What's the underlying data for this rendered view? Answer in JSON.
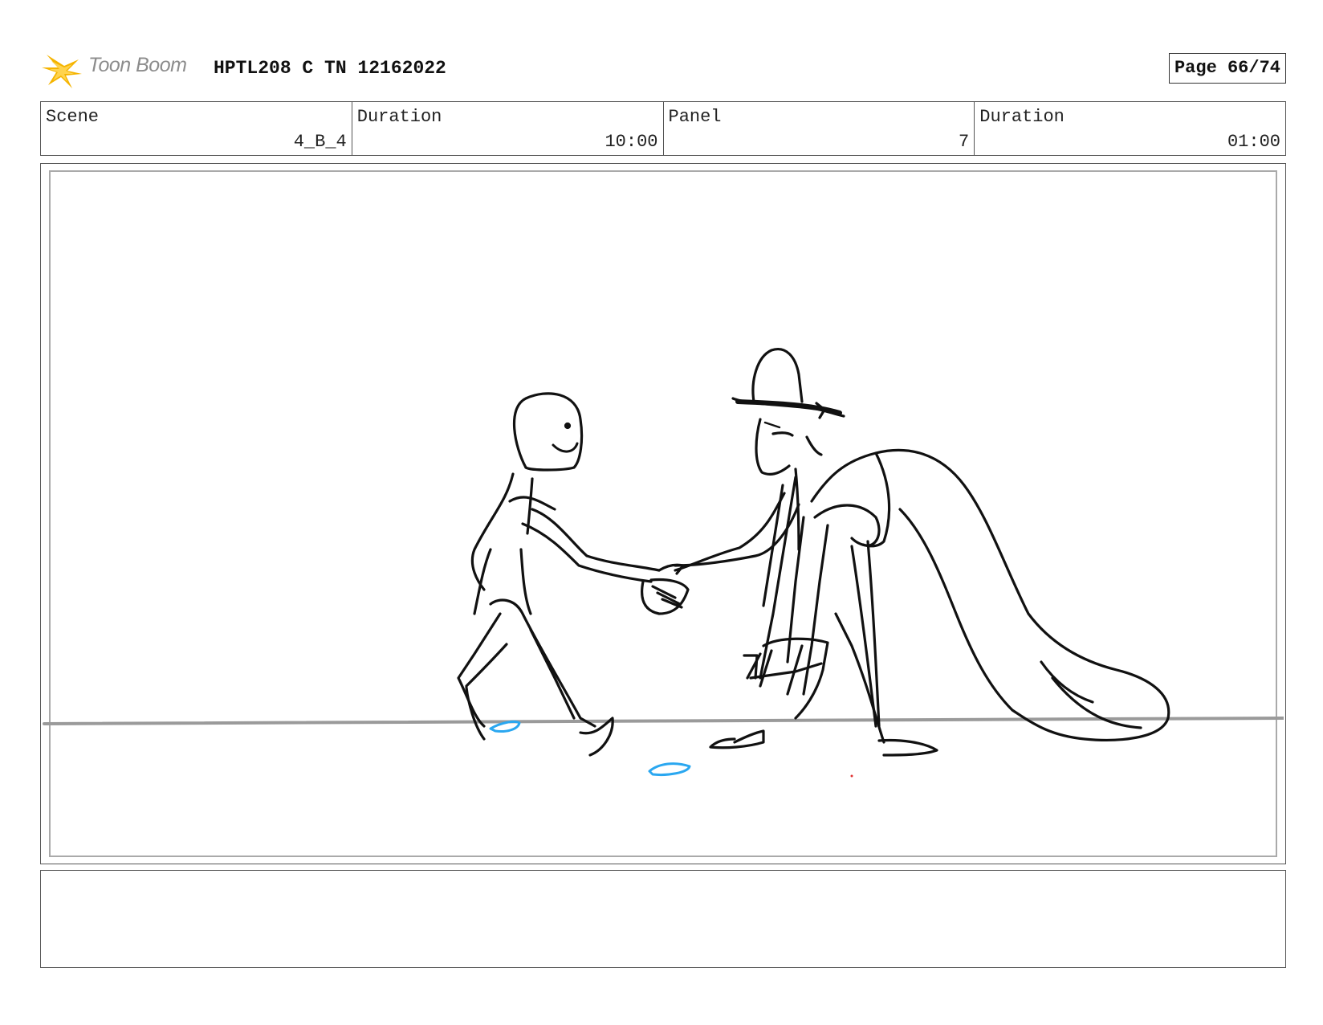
{
  "header": {
    "logo_text": "Toon Boom",
    "document_title": "HPTL208 C TN 12162022",
    "page_label": "Page 66/74"
  },
  "info": {
    "scene_label": "Scene",
    "scene_value": "4_B_4",
    "scene_duration_label": "Duration",
    "scene_duration_value": "10:00",
    "panel_label": "Panel",
    "panel_value": "7",
    "panel_duration_label": "Duration",
    "panel_duration_value": "01:00"
  },
  "notes": {
    "text": ""
  },
  "colors": {
    "logo_star": "#f5b400",
    "sketch_line": "#111111",
    "ground_line": "#9a9a9a",
    "footstep_marks": "#2aa7f0"
  }
}
